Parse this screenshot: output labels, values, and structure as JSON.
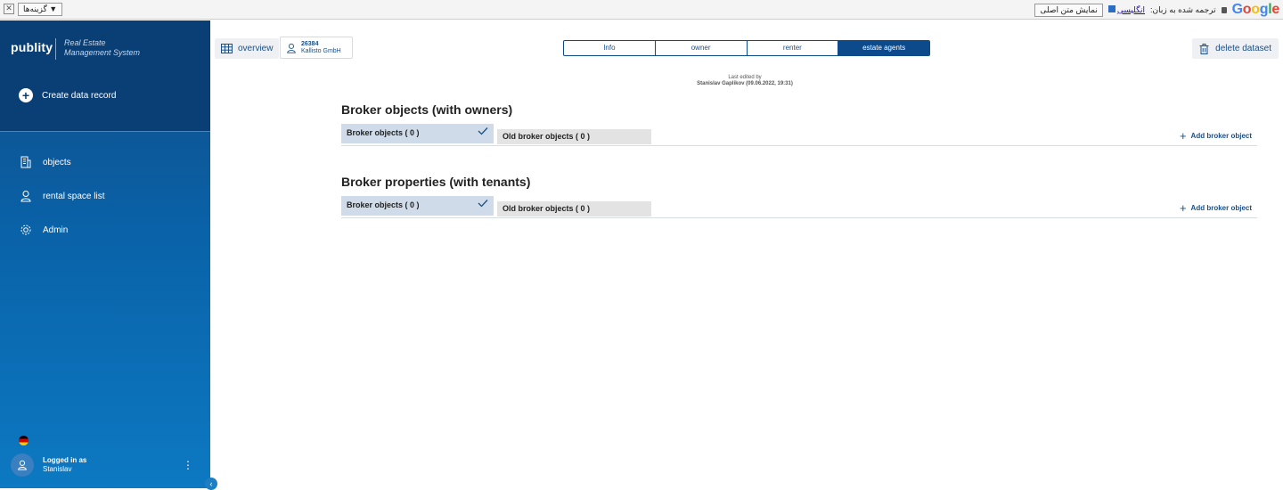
{
  "translate_bar": {
    "options_label": "گزینه‌ها ▼",
    "translated_to": "ترجمه شده به زبان:",
    "language": "انگلیسی",
    "show_original": "نمایش متن اصلی",
    "brand": "Google"
  },
  "sidebar": {
    "brand": "publity",
    "brand_sub_1": "Real Estate",
    "brand_sub_2": "Management System",
    "create_label": "Create data record",
    "items": [
      {
        "label": "objects",
        "icon": "building-icon"
      },
      {
        "label": "rental space list",
        "icon": "person-icon"
      },
      {
        "label": "Admin",
        "icon": "gear-icon"
      }
    ],
    "user": {
      "logged_label": "Logged in as",
      "name": "Stanislav"
    }
  },
  "header": {
    "overview_label": "overview",
    "record_number": "26384",
    "record_name": "Kallisto GmbH",
    "tabs": [
      {
        "label": "Info",
        "active": false
      },
      {
        "label": "owner",
        "active": false
      },
      {
        "label": "renter",
        "active": false
      },
      {
        "label": "estate agents",
        "active": true
      }
    ],
    "delete_label": "delete dataset"
  },
  "edited": {
    "label": "Last edited by",
    "by": "Stanislav Gaplikov (09.06.2022, 19:31)"
  },
  "sections": [
    {
      "title": "Broker objects (with owners)",
      "tab_active": "Broker objects ( 0 )",
      "tab_other": "Old broker objects ( 0 )",
      "add_label": "Add broker object"
    },
    {
      "title": "Broker properties (with tenants)",
      "tab_active": "Broker objects ( 0 )",
      "tab_other": "Old broker objects ( 0 )",
      "add_label": "Add broker object"
    }
  ],
  "colors": {
    "primary": "#0d4a8b",
    "sidebar_top": "#0a3f76",
    "sidebar_bottom": "#0c79c2"
  }
}
